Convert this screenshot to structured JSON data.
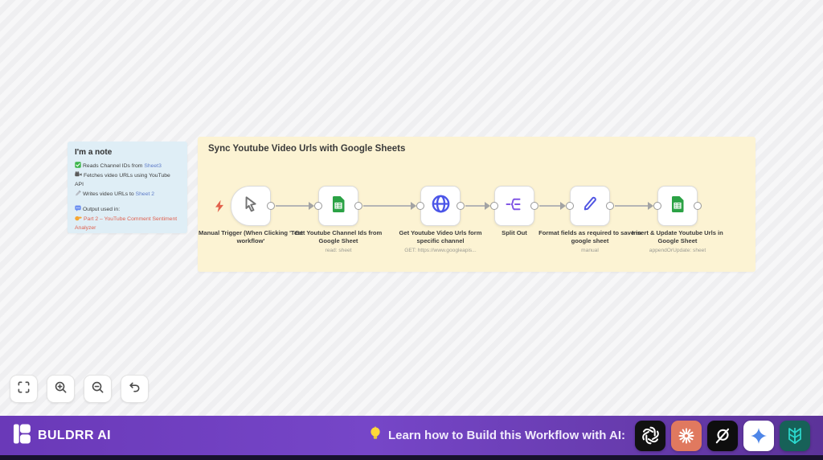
{
  "note": {
    "title": "I'm a note",
    "read_line": {
      "text": "Reads Channel IDs from ",
      "link": "Sheet3"
    },
    "fetch_line": {
      "text": "Fetches video URLs using YouTube API"
    },
    "write_line": {
      "text": "Writes video URLs to ",
      "link": "Sheet 2"
    },
    "output_line": {
      "text": "Output used in:"
    },
    "part2_line": {
      "text": "Part 2 – YouTube Comment Sentiment Analyzer"
    }
  },
  "workflow": {
    "title": "Sync Youtube Video Urls with Google Sheets",
    "nodes": [
      {
        "title": "Manual Trigger (When Clicking 'Test workflow'",
        "subtitle": "",
        "icon": "cursor-icon"
      },
      {
        "title": "Get Youtube Channel Ids from Google Sheet",
        "subtitle": "read: sheet",
        "icon": "google-sheets-icon"
      },
      {
        "title": "Get Youtube Video Urls form specific channel",
        "subtitle": "GET: https://www.googleapis...",
        "icon": "globe-icon"
      },
      {
        "title": "Split Out",
        "subtitle": "",
        "icon": "split-out-icon"
      },
      {
        "title": "Format fields as required to save in google sheet",
        "subtitle": "manual",
        "icon": "pencil-icon"
      },
      {
        "title": "Insert & Update Youtube Urls in Google Sheet",
        "subtitle": "appendOrUpdate: sheet",
        "icon": "google-sheets-icon"
      }
    ]
  },
  "toolbar": {
    "buttons": [
      "fit-view",
      "zoom-in",
      "zoom-out",
      "undo"
    ]
  },
  "footer": {
    "brand": "BULDRR AI",
    "cta": "Learn how to Build this Workflow with AI:",
    "ai_tools": [
      "OpenAI",
      "Claude",
      "Grok",
      "Gemini",
      "Perplexity"
    ]
  },
  "colors": {
    "note_blue": "#dfeef6",
    "note_yellow": "#fcf3d3",
    "link_blue": "#5e7cc8",
    "alert_red": "#e0604e",
    "sheets_green": "#2ba245",
    "globe_indigo": "#4b55e8",
    "split_purple": "#8257e5",
    "footer_purple": "#7646c8",
    "claude_coral": "#e0795f",
    "perplexity_teal": "#176158"
  }
}
